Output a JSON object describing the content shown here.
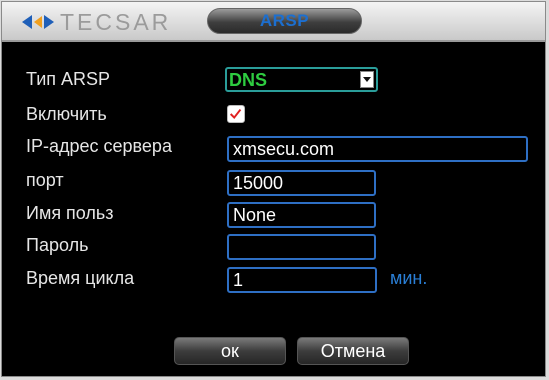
{
  "titlebar": {
    "logo_text": "TECSAR",
    "tab_title": "ARSP"
  },
  "form": {
    "type": {
      "label": "Тип ARSP",
      "value": "DNS"
    },
    "enable": {
      "label": "Включить",
      "checked": true
    },
    "server": {
      "label": "IP-адрес сервера",
      "value": "xmsecu.com"
    },
    "port": {
      "label": "порт",
      "value": "15000"
    },
    "username": {
      "label": "Имя польз",
      "value": "None"
    },
    "password": {
      "label": "Пароль",
      "value": ""
    },
    "cycle": {
      "label": "Время цикла",
      "value": "1",
      "unit": "мин."
    }
  },
  "buttons": {
    "ok_label": "ок",
    "cancel_label": "Отмена"
  },
  "colors": {
    "accent_blue": "#2e6fc4",
    "select_value_green": "#2ecc40",
    "checkmark_red": "#e02020",
    "title_blue": "#1c6fd0"
  },
  "icons": {
    "logo": "teksar-arrows-logo",
    "dropdown": "caret-down-icon",
    "check": "checkmark-icon"
  }
}
